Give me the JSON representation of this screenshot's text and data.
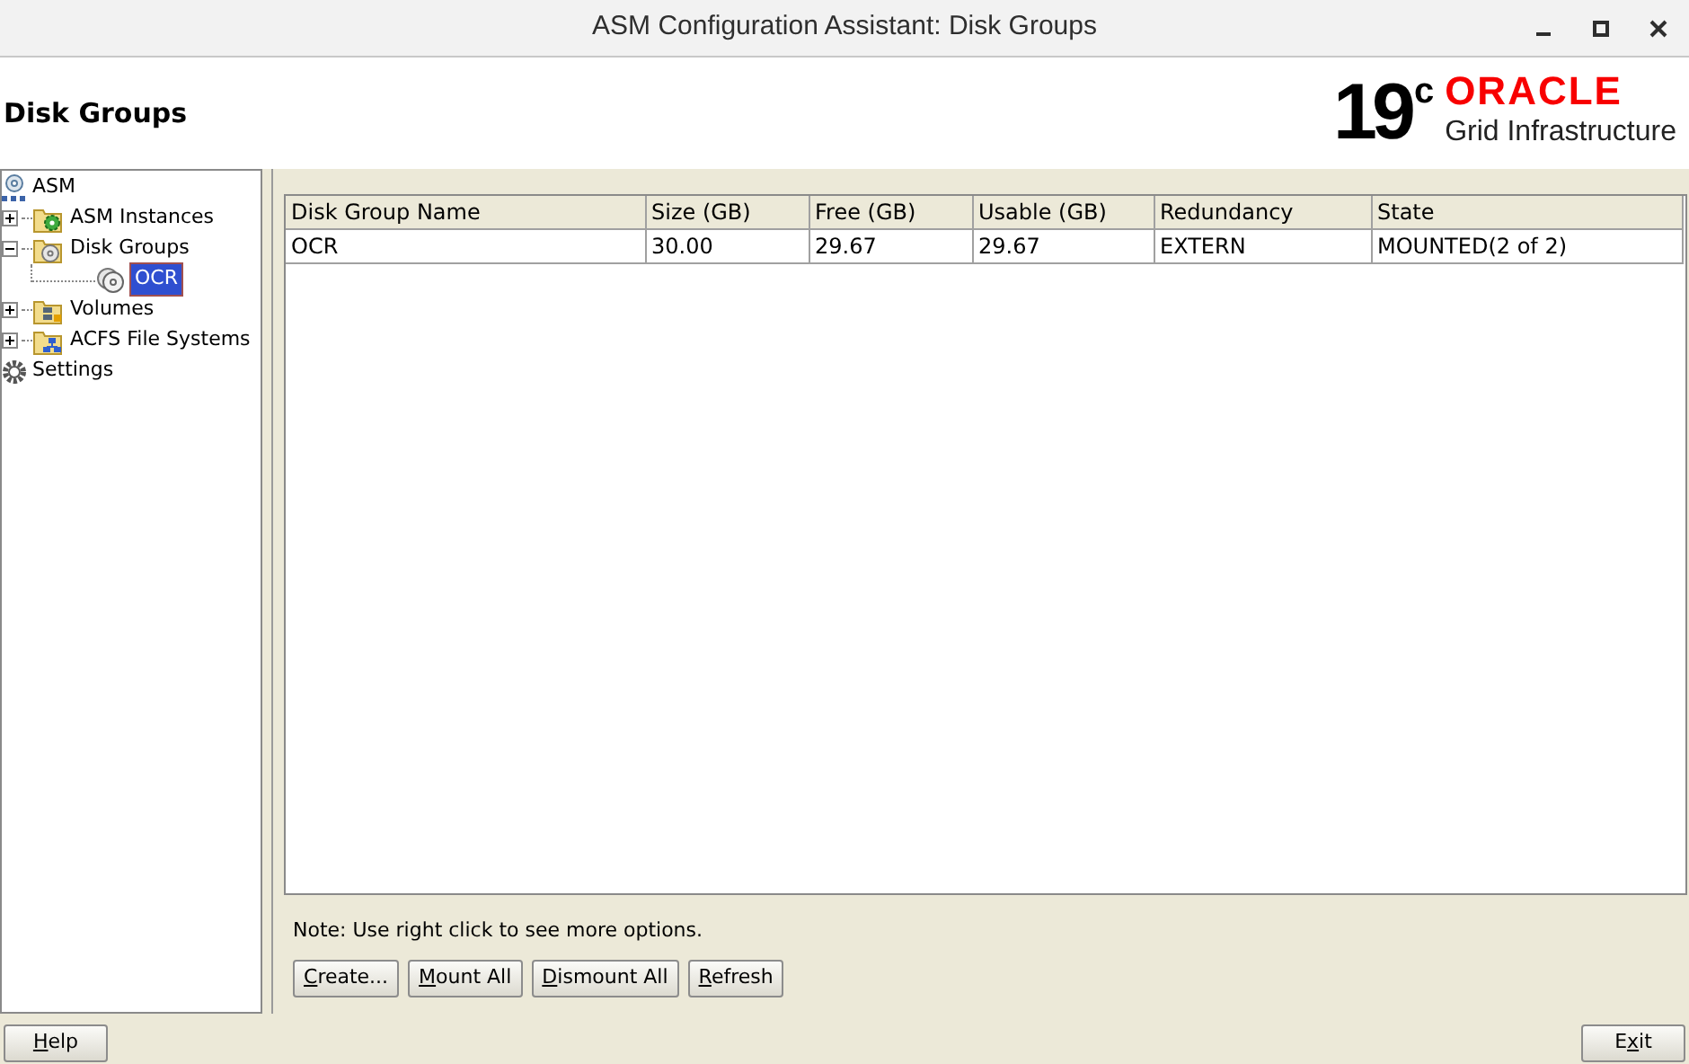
{
  "window": {
    "title": "ASM Configuration Assistant: Disk Groups"
  },
  "header": {
    "title": "Disk Groups",
    "logo_version": "19",
    "logo_suffix": "c",
    "logo_brand": "ORACLE",
    "logo_product": "Grid Infrastructure"
  },
  "tree": [
    {
      "label": "ASM",
      "kind": "root",
      "expanded": true,
      "selected": false,
      "children": [
        {
          "label": "ASM Instances",
          "kind": "instances",
          "expanded": false,
          "selected": false
        },
        {
          "label": "Disk Groups",
          "kind": "diskgroups",
          "expanded": true,
          "selected": false,
          "children": [
            {
              "label": "OCR",
              "kind": "disk",
              "selected": true
            }
          ]
        },
        {
          "label": "Volumes",
          "kind": "volumes",
          "expanded": false,
          "selected": false
        },
        {
          "label": "ACFS File Systems",
          "kind": "acfs",
          "expanded": false,
          "selected": false
        }
      ]
    },
    {
      "label": "Settings",
      "kind": "settings",
      "selected": false
    }
  ],
  "table": {
    "columns": [
      "Disk Group Name",
      "Size (GB)",
      "Free (GB)",
      "Usable (GB)",
      "Redundancy",
      "State"
    ],
    "rows": [
      [
        "OCR",
        "30.00",
        "29.67",
        "29.67",
        "EXTERN",
        "MOUNTED(2 of 2)"
      ]
    ]
  },
  "note": "Note: Use right click to see more options.",
  "buttons": [
    {
      "key": "C",
      "after": "reate..."
    },
    {
      "key": "M",
      "after": "ount All"
    },
    {
      "key": "D",
      "after": "ismount All"
    },
    {
      "key": "R",
      "after": "efresh"
    }
  ],
  "footer_buttons": [
    {
      "key": "H",
      "after": "elp"
    },
    {
      "before": "E",
      "key": "x",
      "after": "it"
    }
  ]
}
